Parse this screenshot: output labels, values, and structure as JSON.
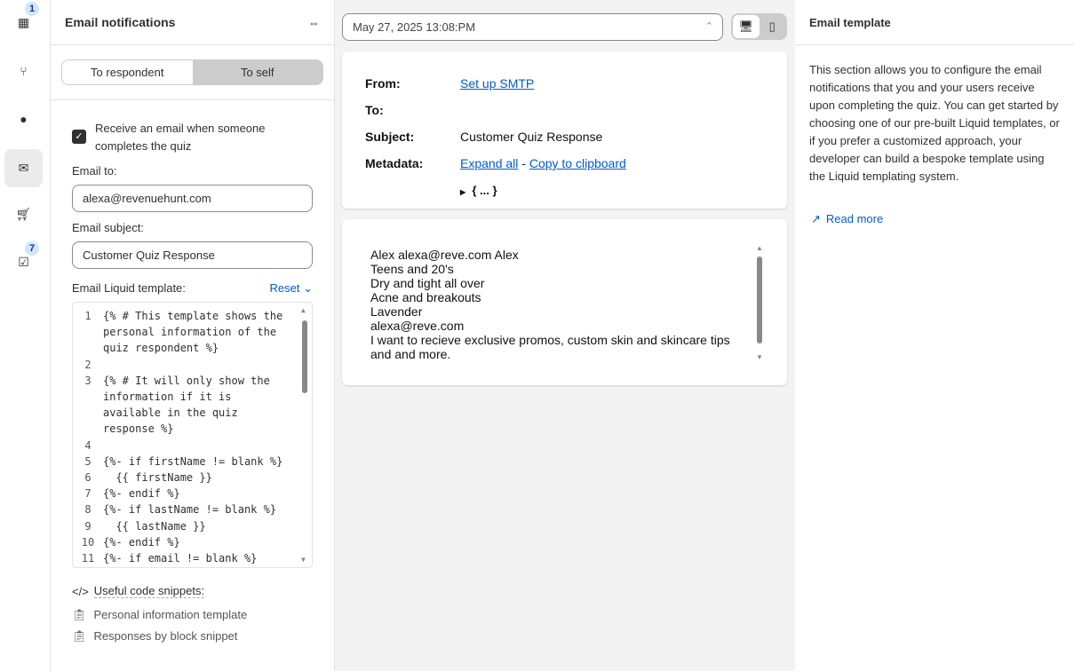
{
  "rail": [
    {
      "icon": "blocks-icon",
      "badge": "1"
    },
    {
      "icon": "branch-icon"
    },
    {
      "icon": "drop-icon"
    },
    {
      "icon": "mail-icon",
      "active": true
    },
    {
      "icon": "cart-icon"
    },
    {
      "icon": "checklist-icon",
      "badge": "7"
    }
  ],
  "left": {
    "title": "Email notifications",
    "tabs": [
      "To respondent",
      "To self"
    ],
    "checkbox_label": "Receive an email when someone completes the quiz",
    "email_to_label": "Email to:",
    "email_to": "alexa@revenuehunt.com",
    "subject_label": "Email subject:",
    "subject": "Customer Quiz Response",
    "template_label": "Email Liquid template:",
    "reset": "Reset",
    "code": [
      [
        "1",
        "{% # This template shows the personal information of the quiz respondent %}"
      ],
      [
        "2",
        ""
      ],
      [
        "3",
        "{% # It will only show the information if it is available in the quiz response %}"
      ],
      [
        "4",
        ""
      ],
      [
        "5",
        "{%- if firstName != blank %}"
      ],
      [
        "6",
        "  {{ firstName }}"
      ],
      [
        "7",
        "{%- endif %}"
      ],
      [
        "8",
        "{%- if lastName != blank %}"
      ],
      [
        "9",
        "  {{ lastName }}"
      ],
      [
        "10",
        "{%- endif %}"
      ],
      [
        "11",
        "{%- if email != blank %}"
      ]
    ],
    "snippets_label": "Useful code snippets:",
    "snippets": [
      "Personal information template",
      "Responses by block snippet"
    ]
  },
  "center": {
    "date": "May 27, 2025 13:08:PM",
    "from_label": "From:",
    "from_link": "Set up SMTP",
    "to_label": "To:",
    "subject_label": "Subject:",
    "subject": "Customer Quiz Response",
    "metadata_label": "Metadata:",
    "expand_all": "Expand all",
    "dash": "-",
    "copy": "Copy to clipboard",
    "json_collapsed": "{ ... }",
    "body_lines": [
      "Alex alexa@reve.com Alex",
      "Teens and 20's",
      "Dry and tight all over",
      "Acne and breakouts",
      "Lavender",
      "alexa@reve.com",
      "I want to recieve exclusive promos, custom skin and skincare tips and and more."
    ]
  },
  "right": {
    "title": "Email template",
    "description": "This section allows you to configure the email notifications that you and your users receive upon completing the quiz. You can get started by choosing one of our pre-built Liquid templates, or if you prefer a customized approach, your developer can build a bespoke template using the Liquid templating system.",
    "read_more": "Read more"
  }
}
